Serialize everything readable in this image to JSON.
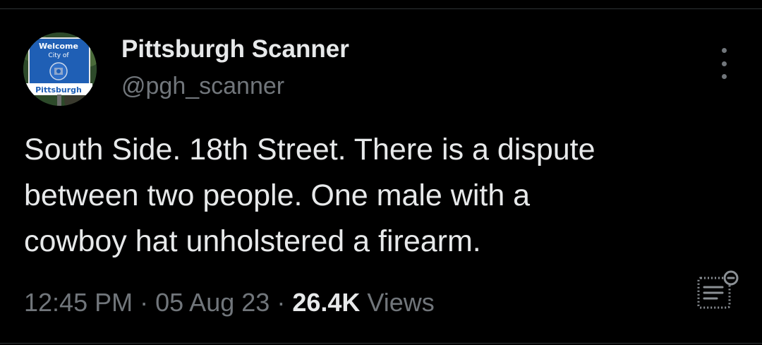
{
  "author": {
    "display_name": "Pittsburgh Scanner",
    "handle": "@pgh_scanner",
    "avatar": {
      "icon": "welcome-sign-avatar",
      "sign_text_line1": "Welcome",
      "sign_text_line2": "City of",
      "sign_text_line3": "Pittsburgh"
    }
  },
  "tweet": {
    "text": "South Side.  18th Street.  There is a dispute\nbetween two people.  One male with a\ncowboy hat unholstered a firearm.",
    "time": "12:45 PM",
    "separator": "·",
    "date": "05 Aug 23",
    "views_count": "26.4K",
    "views_label": "Views"
  },
  "icons": {
    "more": "more-options-icon",
    "analytics": "analytics-icon"
  },
  "colors": {
    "background": "#000000",
    "primary_text": "#e7e9ea",
    "secondary_text": "#71767b",
    "divider": "#2f3336"
  }
}
